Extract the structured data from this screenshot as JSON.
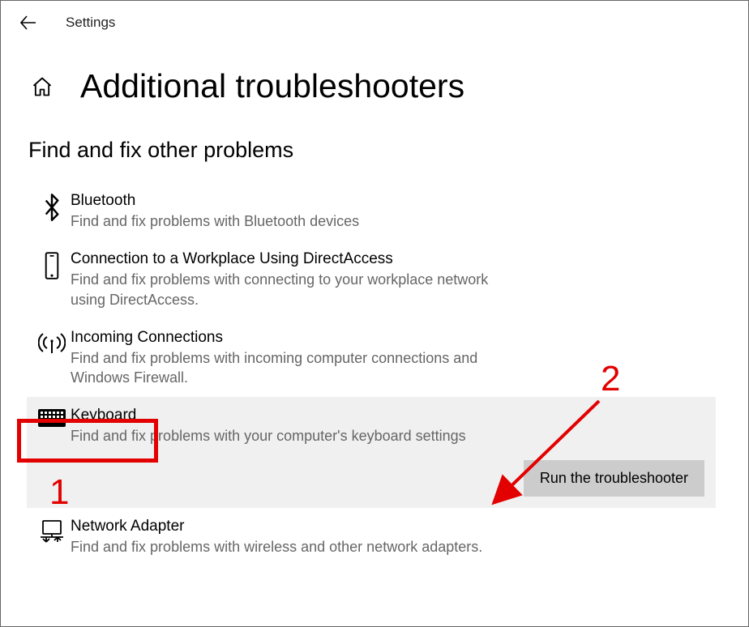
{
  "app_title": "Settings",
  "page_title": "Additional troubleshooters",
  "section_heading": "Find and fix other problems",
  "run_button_label": "Run the troubleshooter",
  "items": [
    {
      "title": "Bluetooth",
      "desc": "Find and fix problems with Bluetooth devices"
    },
    {
      "title": "Connection to a Workplace Using DirectAccess",
      "desc": "Find and fix problems with connecting to your workplace network using DirectAccess."
    },
    {
      "title": "Incoming Connections",
      "desc": "Find and fix problems with incoming computer connections and Windows Firewall."
    },
    {
      "title": "Keyboard",
      "desc": "Find and fix problems with your computer's keyboard settings"
    },
    {
      "title": "Network Adapter",
      "desc": "Find and fix problems with wireless and other network adapters."
    }
  ],
  "annotations": {
    "num1": "1",
    "num2": "2"
  }
}
